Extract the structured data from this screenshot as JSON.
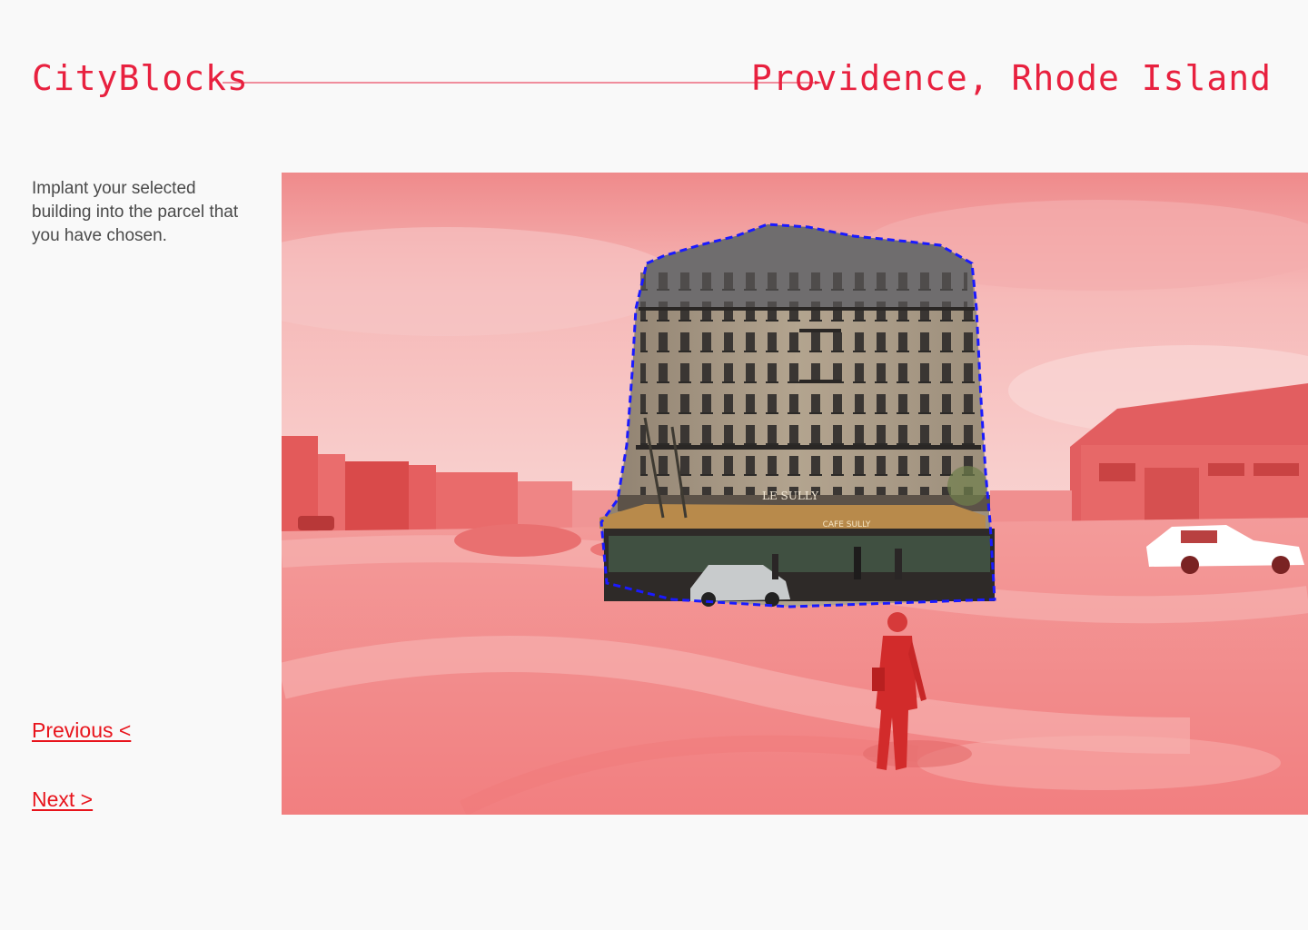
{
  "header": {
    "brand": "CityBlocks",
    "location": "Providence, Rhode Island"
  },
  "instructions": {
    "text": "Implant your selected building into the parcel that you have chosen."
  },
  "navigation": {
    "previous_label": "Previous <",
    "next_label": "Next >"
  },
  "scene": {
    "building_sign": "LE SULLY",
    "awning_sign": "CAFE SULLY"
  },
  "colors": {
    "accent": "#e8213f",
    "selection_outline": "#1a1aff",
    "scene_tint": "#f07f7f"
  }
}
